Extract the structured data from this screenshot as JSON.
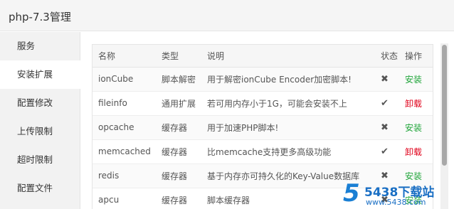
{
  "window": {
    "title": "php-7.3管理"
  },
  "sidebar": {
    "items": [
      {
        "label": "服务",
        "active": false
      },
      {
        "label": "安装扩展",
        "active": true
      },
      {
        "label": "配置修改",
        "active": false
      },
      {
        "label": "上传限制",
        "active": false
      },
      {
        "label": "超时限制",
        "active": false
      },
      {
        "label": "配置文件",
        "active": false
      }
    ]
  },
  "table": {
    "headers": {
      "name": "名称",
      "type": "类型",
      "desc": "说明",
      "status": "状态",
      "op": "操作"
    },
    "rows": [
      {
        "name": "ionCube",
        "type": "脚本解密",
        "desc": "用于解密ionCube Encoder加密脚本!",
        "status": "not-installed",
        "status_glyph": "✖",
        "op": "安装",
        "op_color": "#20a53a"
      },
      {
        "name": "fileinfo",
        "type": "通用扩展",
        "desc": "若可用内存小于1G，可能会安装不上",
        "status": "installed",
        "status_glyph": "✔",
        "op": "卸载",
        "op_color": "#e0001a"
      },
      {
        "name": "opcache",
        "type": "缓存器",
        "desc": "用于加速PHP脚本!",
        "status": "not-installed",
        "status_glyph": "✖",
        "op": "安装",
        "op_color": "#20a53a"
      },
      {
        "name": "memcached",
        "type": "缓存器",
        "desc": "比memcache支持更多高级功能",
        "status": "installed",
        "status_glyph": "✔",
        "op": "卸载",
        "op_color": "#e0001a"
      },
      {
        "name": "redis",
        "type": "缓存器",
        "desc": "基于内存亦可持久化的Key-Value数据库",
        "status": "not-installed",
        "status_glyph": "✖",
        "op": "安装",
        "op_color": "#20a53a"
      },
      {
        "name": "apcu",
        "type": "缓存器",
        "desc": "脚本缓存器",
        "status": "not-installed",
        "status_glyph": "✖",
        "op": "安装",
        "op_color": "#20a53a"
      }
    ]
  },
  "watermark": {
    "logo": "5",
    "main": "5438下载站",
    "sub": "www.5438.com"
  },
  "colors": {
    "install": "#20a53a",
    "uninstall": "#e0001a",
    "sidebar_bg": "#f2f2f2"
  }
}
